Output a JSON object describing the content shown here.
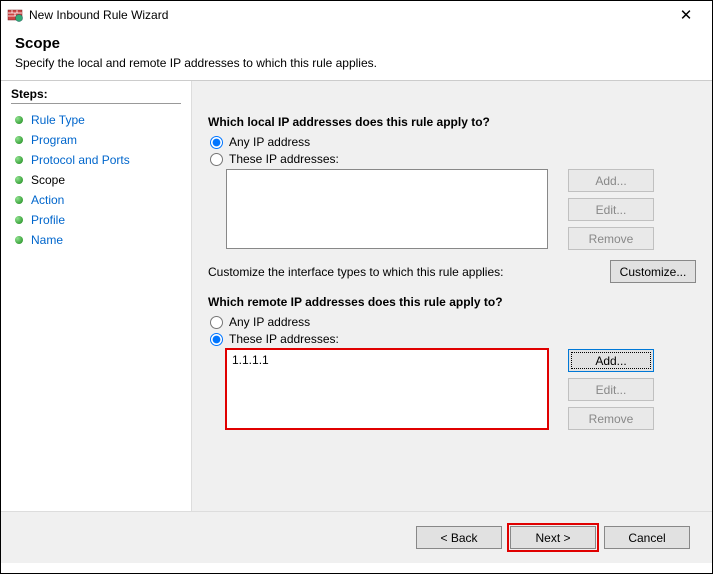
{
  "window": {
    "title": "New Inbound Rule Wizard",
    "close": "✕"
  },
  "header": {
    "title": "Scope",
    "subtitle": "Specify the local and remote IP addresses to which this rule applies."
  },
  "steps": {
    "title": "Steps:",
    "items": [
      {
        "label": "Rule Type"
      },
      {
        "label": "Program"
      },
      {
        "label": "Protocol and Ports"
      },
      {
        "label": "Scope"
      },
      {
        "label": "Action"
      },
      {
        "label": "Profile"
      },
      {
        "label": "Name"
      }
    ]
  },
  "main": {
    "local": {
      "question": "Which local IP addresses does this rule apply to?",
      "opt_any": "Any IP address",
      "opt_these": "These IP addresses:",
      "list": []
    },
    "remote": {
      "question": "Which remote IP addresses does this rule apply to?",
      "opt_any": "Any IP address",
      "opt_these": "These IP addresses:",
      "list": [
        "1.1.1.1"
      ]
    },
    "customize_text": "Customize the interface types to which this rule applies:",
    "buttons": {
      "add": "Add...",
      "edit": "Edit...",
      "remove": "Remove",
      "customize": "Customize..."
    }
  },
  "footer": {
    "back": "< Back",
    "next": "Next >",
    "cancel": "Cancel"
  }
}
